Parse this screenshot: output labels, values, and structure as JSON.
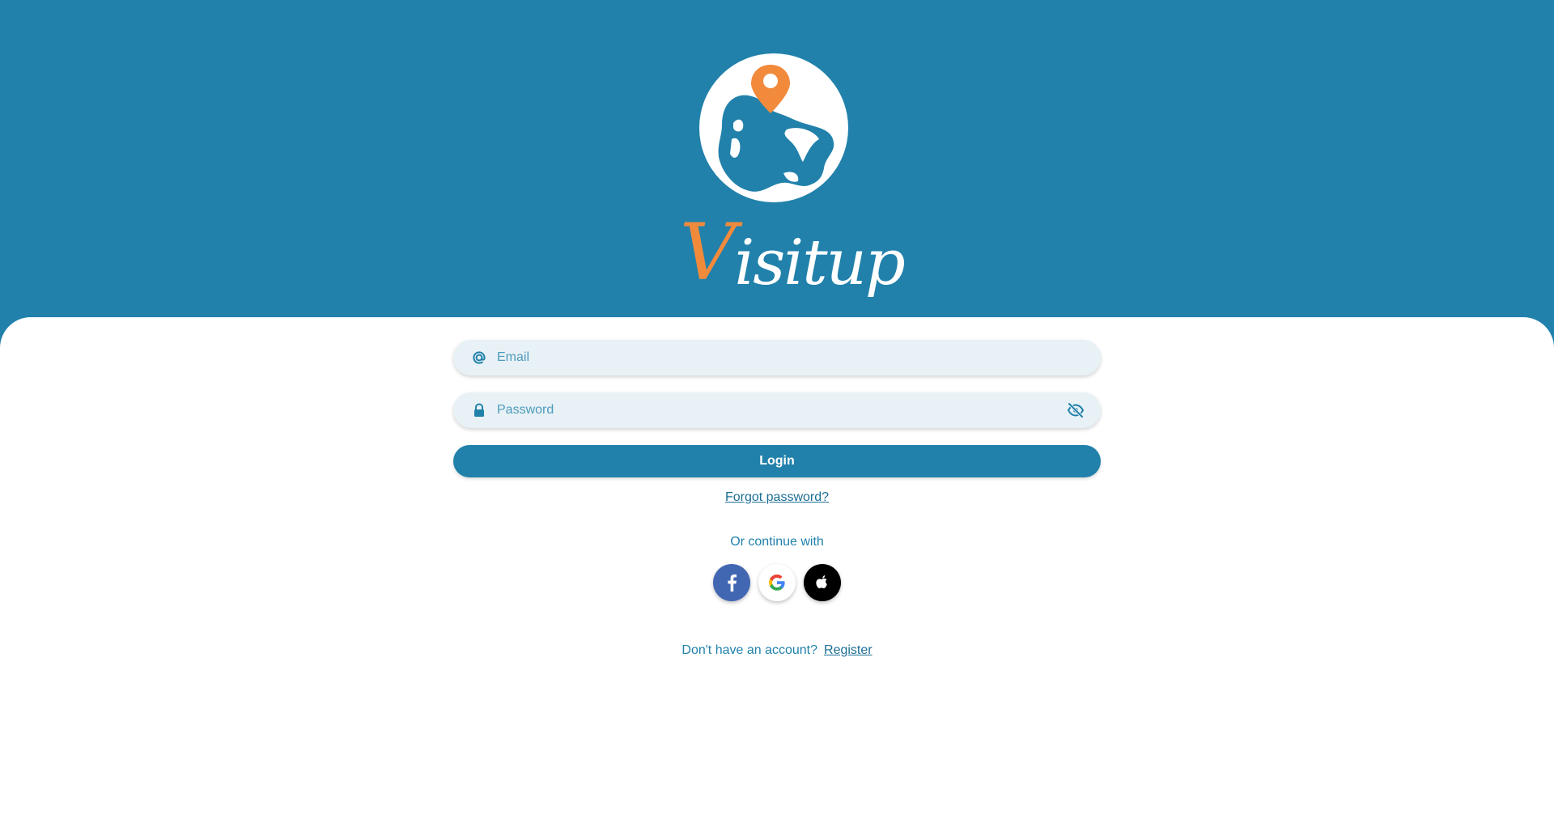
{
  "brand": {
    "name_first_letter": "V",
    "name_rest": "isitup",
    "colors": {
      "primary": "#2181ab",
      "accent": "#f28a3c",
      "field_bg": "#e8f1f5"
    }
  },
  "form": {
    "email": {
      "placeholder": "Email",
      "value": "",
      "icon": "at-icon"
    },
    "password": {
      "placeholder": "Password",
      "value": "",
      "icon": "lock-icon",
      "toggle_icon": "eye-slash-icon"
    },
    "login_label": "Login",
    "forgot_label": "Forgot password?"
  },
  "social": {
    "heading": "Or continue with",
    "providers": [
      "facebook-icon",
      "google-icon",
      "apple-icon"
    ]
  },
  "register": {
    "prompt": "Don't have an account?",
    "link_label": "Register"
  }
}
